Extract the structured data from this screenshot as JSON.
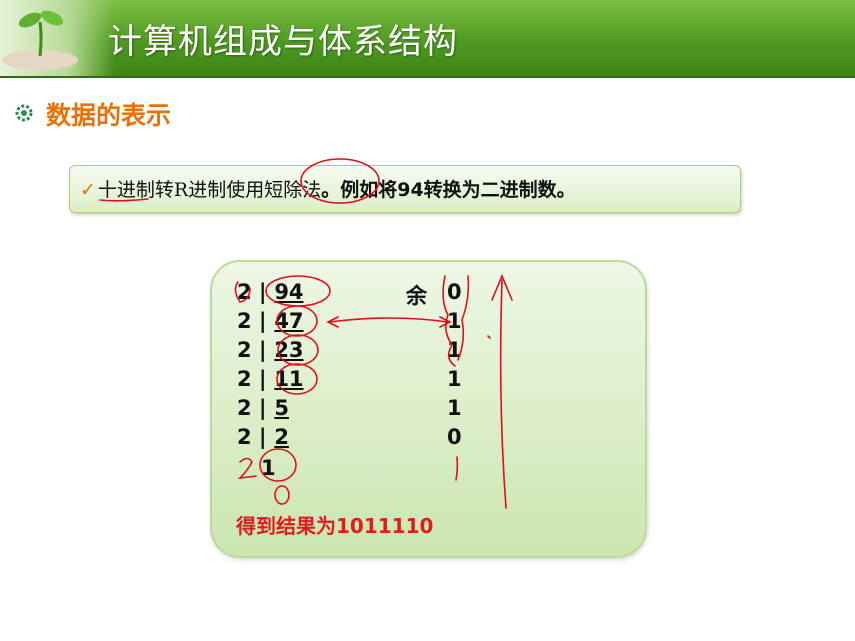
{
  "header": {
    "title": "计算机组成与体系结构"
  },
  "section": {
    "title": "数据的表示"
  },
  "note": {
    "check": "✓",
    "part1": "十进制转R进制使用短除法",
    "part2": "。例如将94转换为二进制数。"
  },
  "calc": {
    "divisor": "2 |",
    "remainder_label": "余",
    "rows": [
      {
        "quotient": "94",
        "remainder": "0"
      },
      {
        "quotient": "47",
        "remainder": "1"
      },
      {
        "quotient": "23",
        "remainder": "1"
      },
      {
        "quotient": "11",
        "remainder": "1"
      },
      {
        "quotient": "5",
        "remainder": "1"
      },
      {
        "quotient": "2",
        "remainder": "0"
      }
    ],
    "final_quotient": "1",
    "result": "得到结果为1011110"
  },
  "colors": {
    "header": "#4f9a22",
    "accent": "#e8720a",
    "result": "#e21b1b"
  }
}
